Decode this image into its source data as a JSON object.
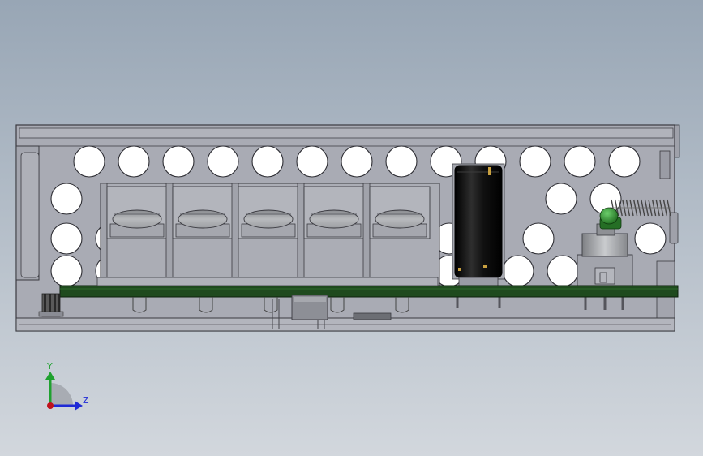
{
  "triad": {
    "y_label": "Y",
    "z_label": "Z",
    "y_color": "#1fa12f",
    "z_color": "#1f2ad6",
    "x_color": "#c0121c"
  },
  "colors": {
    "background_top": "#98a6b5",
    "background_bottom": "#d2d7dd",
    "enclosure": "#a9abb4",
    "pcb": "#1f4a1e",
    "capacitor": "#141414",
    "led": "#2c8a2c",
    "spring": "#4a4a4a"
  }
}
